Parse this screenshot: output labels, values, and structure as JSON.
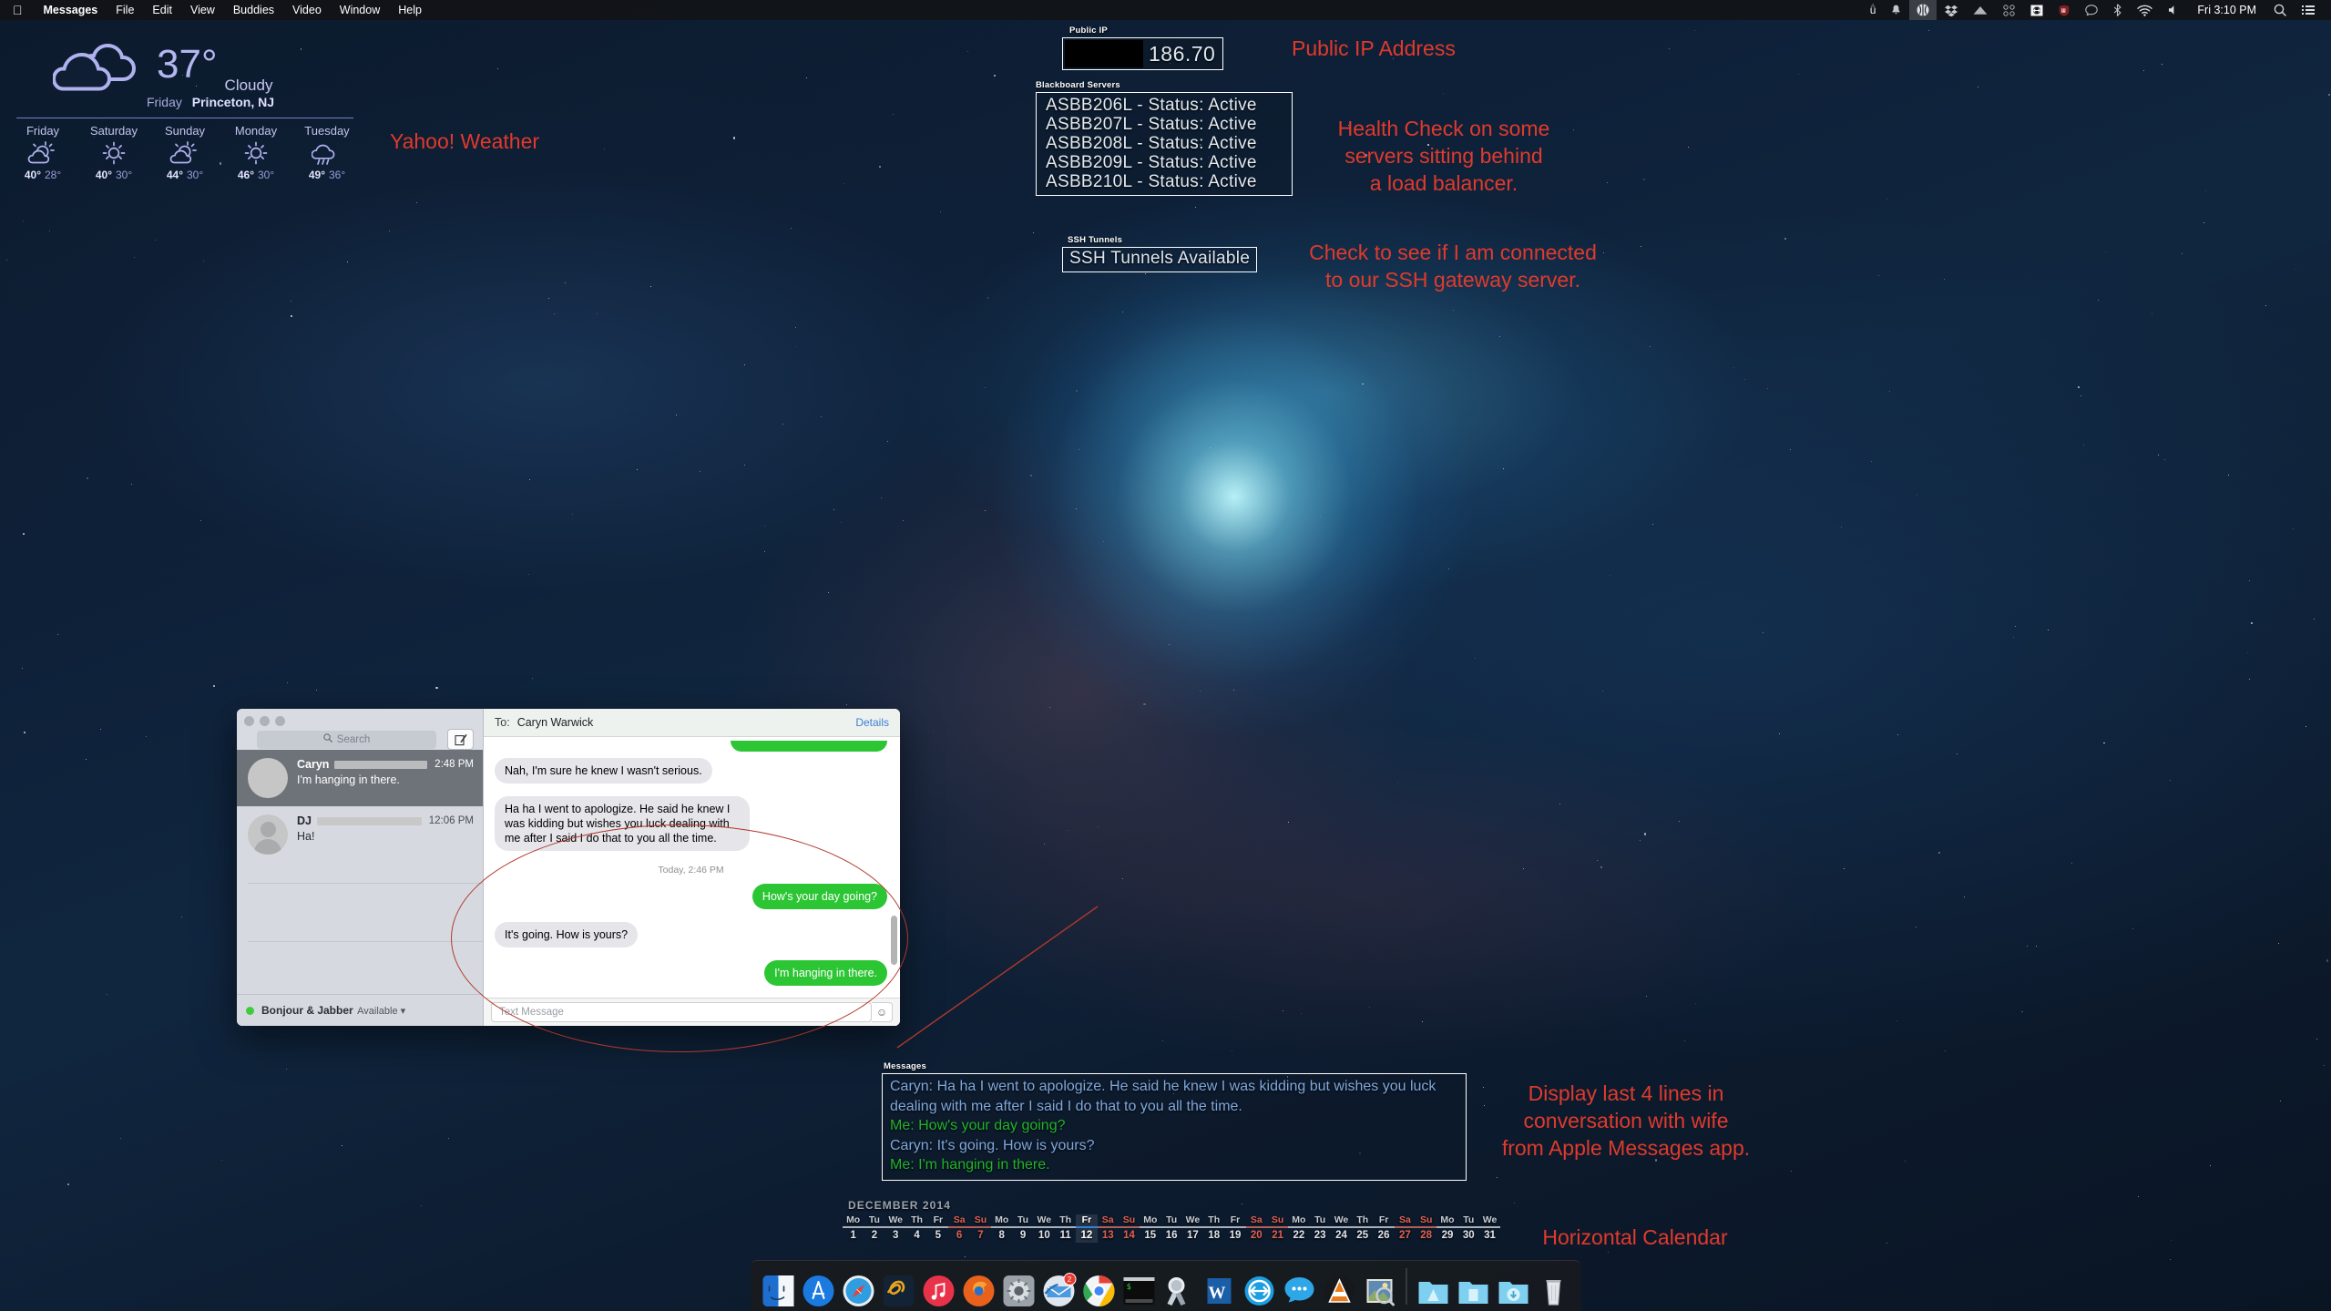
{
  "menubar": {
    "apple_icon": "apple-logo-icon",
    "items": [
      "Messages",
      "File",
      "Edit",
      "View",
      "Buddies",
      "Video",
      "Window",
      "Help"
    ],
    "right_icons": [
      {
        "name": "ucompress-icon",
        "glyph": "ü"
      },
      {
        "name": "bell-icon",
        "glyph": "🔔"
      },
      {
        "name": "dropbox-sync-icon",
        "glyph": "✻"
      },
      {
        "name": "dropbox-icon",
        "glyph": "❖"
      },
      {
        "name": "backup-icon",
        "glyph": "⬟"
      },
      {
        "name": "circles-icon",
        "glyph": "⠿"
      },
      {
        "name": "vpn-icon",
        "glyph": "↔"
      },
      {
        "name": "shield-icon",
        "glyph": "⛨"
      },
      {
        "name": "messages-icon",
        "glyph": "💬"
      },
      {
        "name": "bluetooth-icon",
        "glyph": "ᛦ"
      },
      {
        "name": "wifi-icon",
        "glyph": "◓"
      },
      {
        "name": "volume-icon",
        "glyph": "🔈"
      }
    ],
    "clock": "Fri 3:10 PM",
    "search_icon": "spotlight-search-icon",
    "notification_icon": "notification-center-icon"
  },
  "weather": {
    "temperature": "37°",
    "condition": "Cloudy",
    "day": "Friday",
    "location": "Princeton, NJ",
    "icon": "cloudy-icon",
    "forecast": [
      {
        "day": "Friday",
        "icon": "partly-cloudy-icon",
        "high": "40°",
        "low": "28°"
      },
      {
        "day": "Saturday",
        "icon": "sunny-icon",
        "high": "40°",
        "low": "30°"
      },
      {
        "day": "Sunday",
        "icon": "partly-cloudy-icon",
        "high": "44°",
        "low": "30°"
      },
      {
        "day": "Monday",
        "icon": "sunny-icon",
        "high": "46°",
        "low": "30°"
      },
      {
        "day": "Tuesday",
        "icon": "rain-icon",
        "high": "49°",
        "low": "36°"
      }
    ]
  },
  "public_ip": {
    "label": "Public IP",
    "value": "186.70",
    "redacted": true
  },
  "blackboard": {
    "label": "Blackboard Servers",
    "rows": [
      "ASBB206L - Status: Active",
      "ASBB207L - Status: Active",
      "ASBB208L - Status: Active",
      "ASBB209L - Status: Active",
      "ASBB210L - Status: Active"
    ]
  },
  "ssh": {
    "label": "SSH Tunnels",
    "value": "SSH Tunnels Available"
  },
  "annotations": {
    "color": "#e03a2c",
    "weather": "Yahoo! Weather",
    "public_ip": "Public IP Address",
    "health_check": "Health Check on some\nservers sitting behind\na load balancer.",
    "ssh": "Check to see if I am connected\nto our SSH gateway server.",
    "messages": "Display last 4 lines in\nconversation with wife\nfrom Apple Messages app.",
    "calendar": "Horizontal Calendar"
  },
  "messages_app": {
    "traffic_lights": [
      "close",
      "minimize",
      "zoom"
    ],
    "search_placeholder": "Search",
    "search_icon": "search-icon",
    "compose_icon": "compose-icon",
    "conversations": [
      {
        "name": "Caryn",
        "time": "2:48 PM",
        "preview": "I'm hanging in there.",
        "selected": true,
        "avatar": "photo-avatar"
      },
      {
        "name": "DJ",
        "time": "12:06 PM",
        "preview": "Ha!",
        "selected": false,
        "avatar": "person-avatar"
      }
    ],
    "status": {
      "account": "Bonjour & Jabber",
      "availability": "Available",
      "dot_color": "#3ecb3e"
    },
    "header": {
      "to_label": "To:",
      "recipient": "Caryn Warwick",
      "details_label": "Details"
    },
    "bubbles": [
      {
        "side": "me",
        "text": "",
        "clipped": true
      },
      {
        "side": "them",
        "text": "Nah, I'm sure he knew I wasn't serious."
      },
      {
        "side": "them",
        "text": "Ha ha I went to apologize. He said he knew I was kidding but wishes you luck dealing with me after I said I do that to you all the time."
      },
      {
        "side": "timestamp",
        "text": "Today, 2:46 PM"
      },
      {
        "side": "me",
        "text": "How's your day going?"
      },
      {
        "side": "them",
        "text": "It's going. How is yours?"
      },
      {
        "side": "me",
        "text": "I'm hanging in there."
      }
    ],
    "input_placeholder": "Text Message",
    "emoji_icon": "emoji-icon"
  },
  "messages_geeklet": {
    "label": "Messages",
    "lines": [
      {
        "who": "them",
        "text": "Caryn: Ha ha I went to apologize. He said he knew I was kidding but wishes you luck dealing with me after I said I do that to you all the time."
      },
      {
        "who": "me",
        "text": "Me: How's your day going?"
      },
      {
        "who": "them",
        "text": "Caryn: It's going. How is yours?"
      },
      {
        "who": "me",
        "text": "Me: I'm hanging in there."
      }
    ],
    "color_them": "#7fa8dd",
    "color_me": "#22b32a"
  },
  "calendar": {
    "month": "DECEMBER 2014",
    "today": 12,
    "days": [
      {
        "n": 1,
        "w": "Mo",
        "we": false
      },
      {
        "n": 2,
        "w": "Tu",
        "we": false
      },
      {
        "n": 3,
        "w": "We",
        "we": false
      },
      {
        "n": 4,
        "w": "Th",
        "we": false
      },
      {
        "n": 5,
        "w": "Fr",
        "we": false
      },
      {
        "n": 6,
        "w": "Sa",
        "we": true
      },
      {
        "n": 7,
        "w": "Su",
        "we": true
      },
      {
        "n": 8,
        "w": "Mo",
        "we": false
      },
      {
        "n": 9,
        "w": "Tu",
        "we": false
      },
      {
        "n": 10,
        "w": "We",
        "we": false
      },
      {
        "n": 11,
        "w": "Th",
        "we": false
      },
      {
        "n": 12,
        "w": "Fr",
        "we": false
      },
      {
        "n": 13,
        "w": "Sa",
        "we": true
      },
      {
        "n": 14,
        "w": "Su",
        "we": true
      },
      {
        "n": 15,
        "w": "Mo",
        "we": false
      },
      {
        "n": 16,
        "w": "Tu",
        "we": false
      },
      {
        "n": 17,
        "w": "We",
        "we": false
      },
      {
        "n": 18,
        "w": "Th",
        "we": false
      },
      {
        "n": 19,
        "w": "Fr",
        "we": false
      },
      {
        "n": 20,
        "w": "Sa",
        "we": true
      },
      {
        "n": 21,
        "w": "Su",
        "we": true
      },
      {
        "n": 22,
        "w": "Mo",
        "we": false
      },
      {
        "n": 23,
        "w": "Tu",
        "we": false
      },
      {
        "n": 24,
        "w": "We",
        "we": false
      },
      {
        "n": 25,
        "w": "Th",
        "we": false
      },
      {
        "n": 26,
        "w": "Fr",
        "we": false
      },
      {
        "n": 27,
        "w": "Sa",
        "we": true
      },
      {
        "n": 28,
        "w": "Su",
        "we": true
      },
      {
        "n": 29,
        "w": "Mo",
        "we": false
      },
      {
        "n": 30,
        "w": "Tu",
        "we": false
      },
      {
        "n": 31,
        "w": "We",
        "we": false
      }
    ]
  },
  "dock": {
    "items": [
      {
        "name": "finder",
        "running": true
      },
      {
        "name": "app-store",
        "running": false
      },
      {
        "name": "safari",
        "running": false
      },
      {
        "name": "evernote",
        "running": true
      },
      {
        "name": "itunes",
        "running": false
      },
      {
        "name": "firefox",
        "running": true
      },
      {
        "name": "system-preferences",
        "running": false
      },
      {
        "name": "mail",
        "running": true,
        "badge": "2"
      },
      {
        "name": "google-chrome",
        "running": true
      },
      {
        "name": "terminal",
        "running": true
      },
      {
        "name": "xquartz",
        "running": false
      },
      {
        "name": "microsoft-word",
        "running": false
      },
      {
        "name": "teamviewer",
        "running": true
      },
      {
        "name": "messages",
        "running": true
      },
      {
        "name": "vlc",
        "running": true
      },
      {
        "name": "preview",
        "running": true
      }
    ],
    "folders": [
      "applications-folder",
      "documents-folder",
      "downloads-folder"
    ],
    "trash": "trash-icon"
  }
}
